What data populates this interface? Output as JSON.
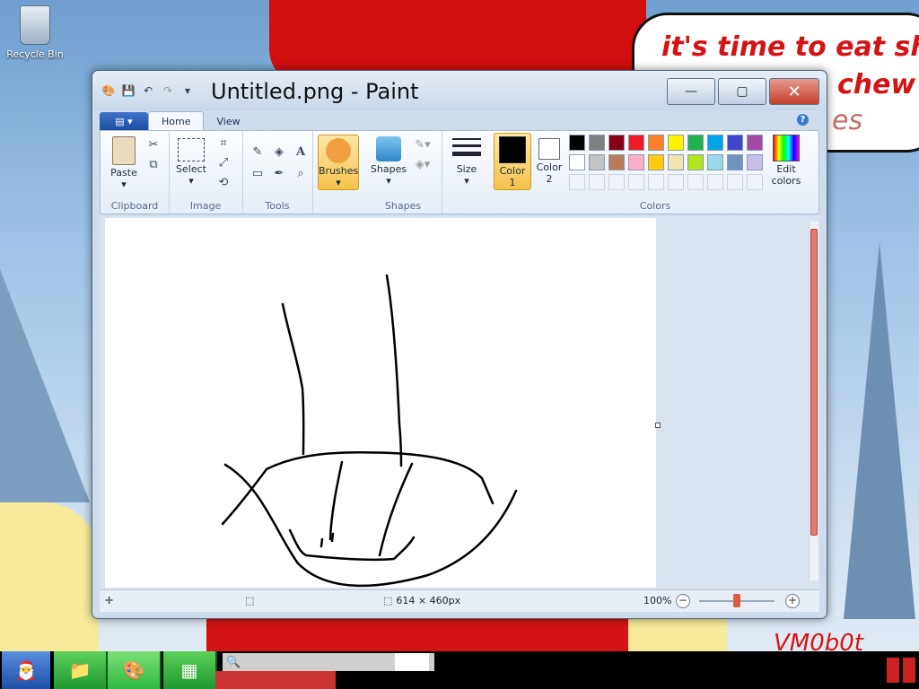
{
  "desktop": {
    "recycle_bin_label": "Recycle Bin",
    "speech_lines": [
      "it's time to eat shit",
      "chew",
      "es"
    ],
    "watermark": "VM0b0t"
  },
  "window": {
    "title": "Untitled.png - Paint",
    "controls": {
      "minimize": "—",
      "maximize": "▢",
      "close": "✕"
    }
  },
  "tabs": {
    "file_icon": "▤ ▾",
    "items": [
      "Home",
      "View"
    ]
  },
  "ribbon": {
    "clipboard": {
      "label": "Clipboard",
      "paste": "Paste"
    },
    "image": {
      "label": "Image",
      "select": "Select"
    },
    "tools": {
      "label": "Tools"
    },
    "brushes": {
      "label": "Brushes"
    },
    "shapes": {
      "label": "Shapes",
      "shapes": "Shapes"
    },
    "size": {
      "label": "Size"
    },
    "colors": {
      "label": "Colors",
      "color1_line1": "Color",
      "color1_line2": "1",
      "color2_line1": "Color",
      "color2_line2": "2",
      "edit_line1": "Edit",
      "edit_line2": "colors",
      "color1": "#000000",
      "color2": "#ffffff",
      "palette_row1": [
        "#000000",
        "#7f7f7f",
        "#880015",
        "#ed1c24",
        "#ff7f27",
        "#fff200",
        "#22b14c",
        "#00a2e8",
        "#3f48cc",
        "#a349a4"
      ],
      "palette_row2": [
        "#ffffff",
        "#c3c3c3",
        "#b97a57",
        "#ffaec9",
        "#ffc90e",
        "#efe4b0",
        "#b5e61d",
        "#99d9ea",
        "#7092be",
        "#c8bfe7"
      ]
    }
  },
  "status": {
    "canvas_size": "614 × 460px",
    "zoom": "100%"
  },
  "taskbar": {
    "search_icon": "🔍"
  }
}
